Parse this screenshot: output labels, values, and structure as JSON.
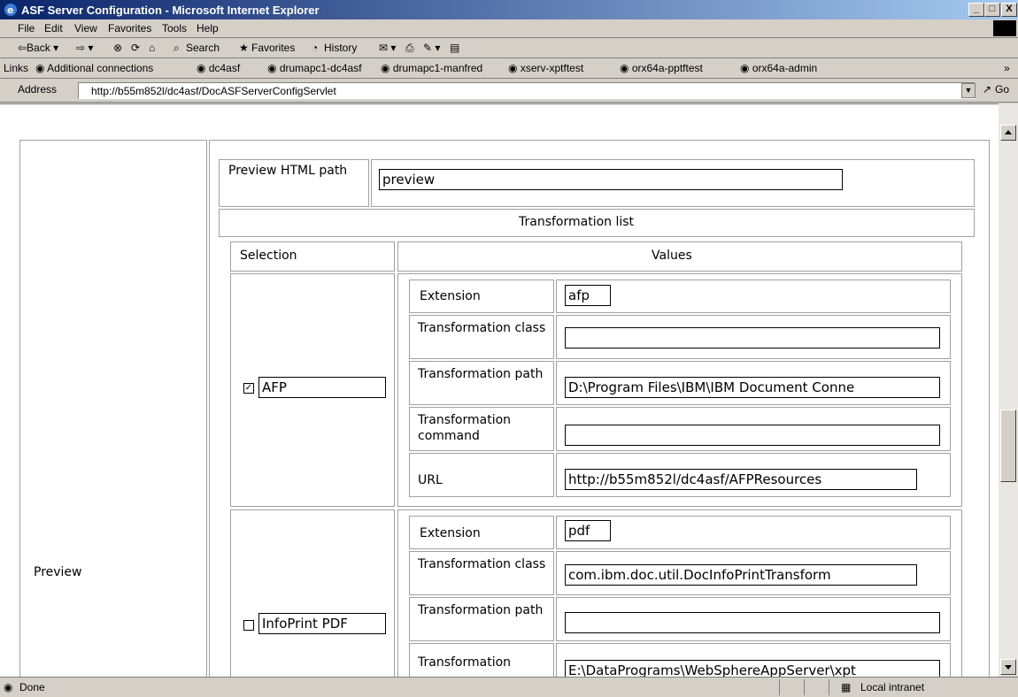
{
  "window": {
    "title": "ASF Server Configuration - Microsoft Internet Explorer",
    "minimize": "_",
    "maximize": "□",
    "close": "X"
  },
  "menu": [
    "File",
    "Edit",
    "View",
    "Favorites",
    "Tools",
    "Help"
  ],
  "toolbar": {
    "back": "⇦Back ▾",
    "forward": "⇨ ▾",
    "search": "Search",
    "favorites": "Favorites",
    "history": "History"
  },
  "links": {
    "label": "Links",
    "items": [
      "Additional connections",
      "dc4asf",
      "drumapc1-dc4asf",
      "drumapc1-manfred",
      "xserv-xptftest",
      "orx64a-pptftest",
      "orx64a-admin"
    ],
    "more": "»"
  },
  "address": {
    "label": "Address",
    "url": "http://b55m852l/dc4asf/DocASFServerConfigServlet",
    "go": "Go"
  },
  "page": {
    "section_label": "Preview",
    "preview_path_label": "Preview HTML path",
    "preview_path_value": "preview",
    "transformation_list_header": "Transformation list",
    "selection_header": "Selection",
    "values_header": "Values",
    "transformations": [
      {
        "name": "AFP",
        "checked": true,
        "fields": [
          {
            "label": "Extension",
            "value": "afp"
          },
          {
            "label": "Transformation class",
            "value": ""
          },
          {
            "label": "Transformation path",
            "value": "D:\\Program Files\\IBM\\IBM Document Conne"
          },
          {
            "label": "Transformation command",
            "value": ""
          },
          {
            "label": "URL",
            "value": "http://b55m852l/dc4asf/AFPResources"
          }
        ]
      },
      {
        "name": "InfoPrint PDF",
        "checked": false,
        "fields": [
          {
            "label": "Extension",
            "value": "pdf"
          },
          {
            "label": "Transformation class",
            "value": "com.ibm.doc.util.DocInfoPrintTransform"
          },
          {
            "label": "Transformation path",
            "value": ""
          },
          {
            "label": "Transformation",
            "value": "E:\\DataPrograms\\WebSphereAppServer\\xpt"
          }
        ]
      }
    ]
  },
  "status": {
    "text": "Done",
    "zone": "Local intranet"
  }
}
